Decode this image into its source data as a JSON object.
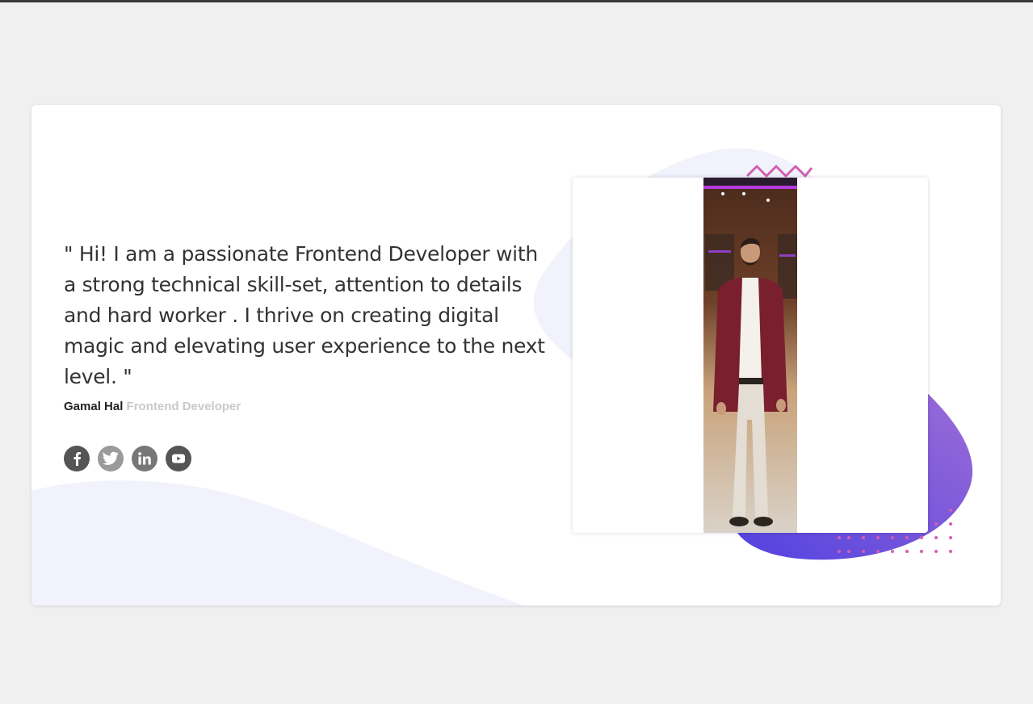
{
  "testimonial": {
    "quote": "\" Hi! I am a passionate Frontend Developer with a strong technical skill-set, attention to details and hard worker . I thrive on creating digital magic and elevating user experience to the next level. \"",
    "author_name": "Gamal Hal",
    "author_role": "Frontend Developer"
  },
  "socials": [
    {
      "icon": "facebook-icon",
      "color": "#555555"
    },
    {
      "icon": "twitter-icon",
      "color": "#9a9a9a"
    },
    {
      "icon": "linkedin-icon",
      "color": "#777777"
    },
    {
      "icon": "youtube-icon",
      "color": "#555555"
    }
  ],
  "colors": {
    "page_bg": "#f0f0f0",
    "card_bg": "#ffffff",
    "blob_light": "#f1f2fb",
    "blob_gradient_start": "#a06fd6",
    "blob_gradient_end": "#5141e0",
    "accent_pink": "#d35fb0"
  }
}
